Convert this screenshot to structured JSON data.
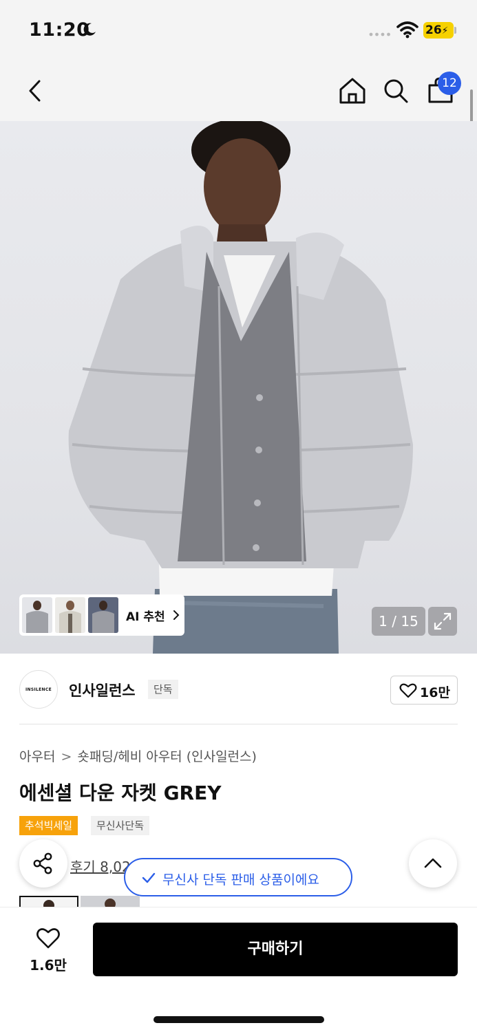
{
  "status_bar": {
    "time": "11:20",
    "battery": "26"
  },
  "nav": {
    "cart_count": "12"
  },
  "product_image": {
    "counter": "1 / 15",
    "ai_recommend_label": "AI 추천"
  },
  "brand": {
    "logo_text": "INSILENCE",
    "name": "인사일런스",
    "tag": "단독",
    "like_count": "16만"
  },
  "breadcrumb": {
    "category": "아우터",
    "subcategory": "숏패딩/헤비 아우터 (인사일런스)"
  },
  "product": {
    "title": "에센셜 다운 자켓 GREY",
    "tags": [
      "추석빅세일",
      "무신사단독"
    ],
    "review_text": "후기 8,02"
  },
  "toast": {
    "message": "무신사 단독 판매 상품이에요"
  },
  "bottom_bar": {
    "wish_count": "1.6만",
    "buy_label": "구매하기"
  },
  "colors": {
    "accent_blue": "#2b5ee8",
    "sale_orange": "#f7a20b",
    "battery_yellow": "#f6d100"
  }
}
